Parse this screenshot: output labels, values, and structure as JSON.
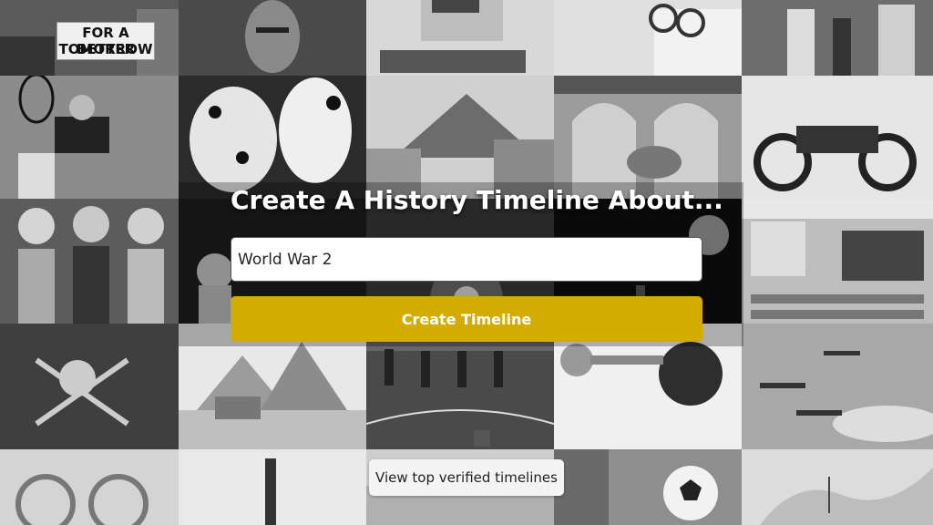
{
  "background": {
    "protest_sign": {
      "line1": "FOR A BETTER",
      "line2": "TOMORROW"
    },
    "tiles": [
      {
        "id": "protest-photo"
      },
      {
        "id": "portrait-painting"
      },
      {
        "id": "vintage-computer"
      },
      {
        "id": "scissors-notebook"
      },
      {
        "id": "street-crowd"
      },
      {
        "id": "tennis-player"
      },
      {
        "id": "paper-lanterns"
      },
      {
        "id": "volcano-town"
      },
      {
        "id": "arched-courtyard"
      },
      {
        "id": "motorcycle"
      },
      {
        "id": "singers-trio"
      },
      {
        "id": "astronaut"
      },
      {
        "id": "telephone-dial"
      },
      {
        "id": "concert-stage"
      },
      {
        "id": "classroom"
      },
      {
        "id": "pirate-flag"
      },
      {
        "id": "pyramids-sphinx"
      },
      {
        "id": "track-race"
      },
      {
        "id": "trumpet-player"
      },
      {
        "id": "aircraft-formation"
      },
      {
        "id": "film-reels"
      },
      {
        "id": "guitar"
      },
      {
        "id": "telephone-cord"
      },
      {
        "id": "soccer-goal"
      },
      {
        "id": "map-pins"
      }
    ]
  },
  "hero": {
    "headline": "Create A History Timeline About...",
    "input_value": "World War 2",
    "create_button": "Create Timeline"
  },
  "footer": {
    "verified_button": "View top verified timelines"
  },
  "colors": {
    "accent": "#d4ac00",
    "headline": "#ffffff"
  }
}
